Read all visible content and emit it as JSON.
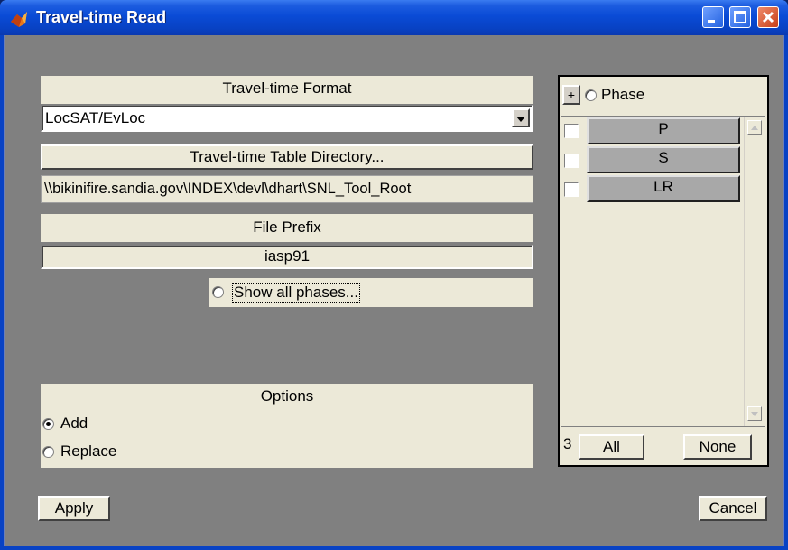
{
  "window": {
    "title": "Travel-time Read"
  },
  "format": {
    "label": "Travel-time Format",
    "selected": "LocSAT/EvLoc"
  },
  "directory": {
    "button_label": "Travel-time Table Directory...",
    "path": "\\\\bikinifire.sandia.gov\\INDEX\\devl\\dhart\\SNL_Tool_Root"
  },
  "prefix": {
    "label": "File Prefix",
    "value": "iasp91"
  },
  "show_all": {
    "label": "Show all phases..."
  },
  "options": {
    "label": "Options",
    "items": [
      "Add",
      "Replace"
    ],
    "selected": "Add"
  },
  "phase_panel": {
    "expand_label": "+",
    "header": "Phase",
    "phases": [
      "P",
      "S",
      "LR"
    ],
    "count": "3",
    "all_label": "All",
    "none_label": "None"
  },
  "buttons": {
    "apply": "Apply",
    "cancel": "Cancel"
  },
  "colors": {
    "titlebar": "#0a4bd6",
    "background": "#808080",
    "panel": "#ece9d8",
    "phase_button": "#a8a8a8"
  }
}
